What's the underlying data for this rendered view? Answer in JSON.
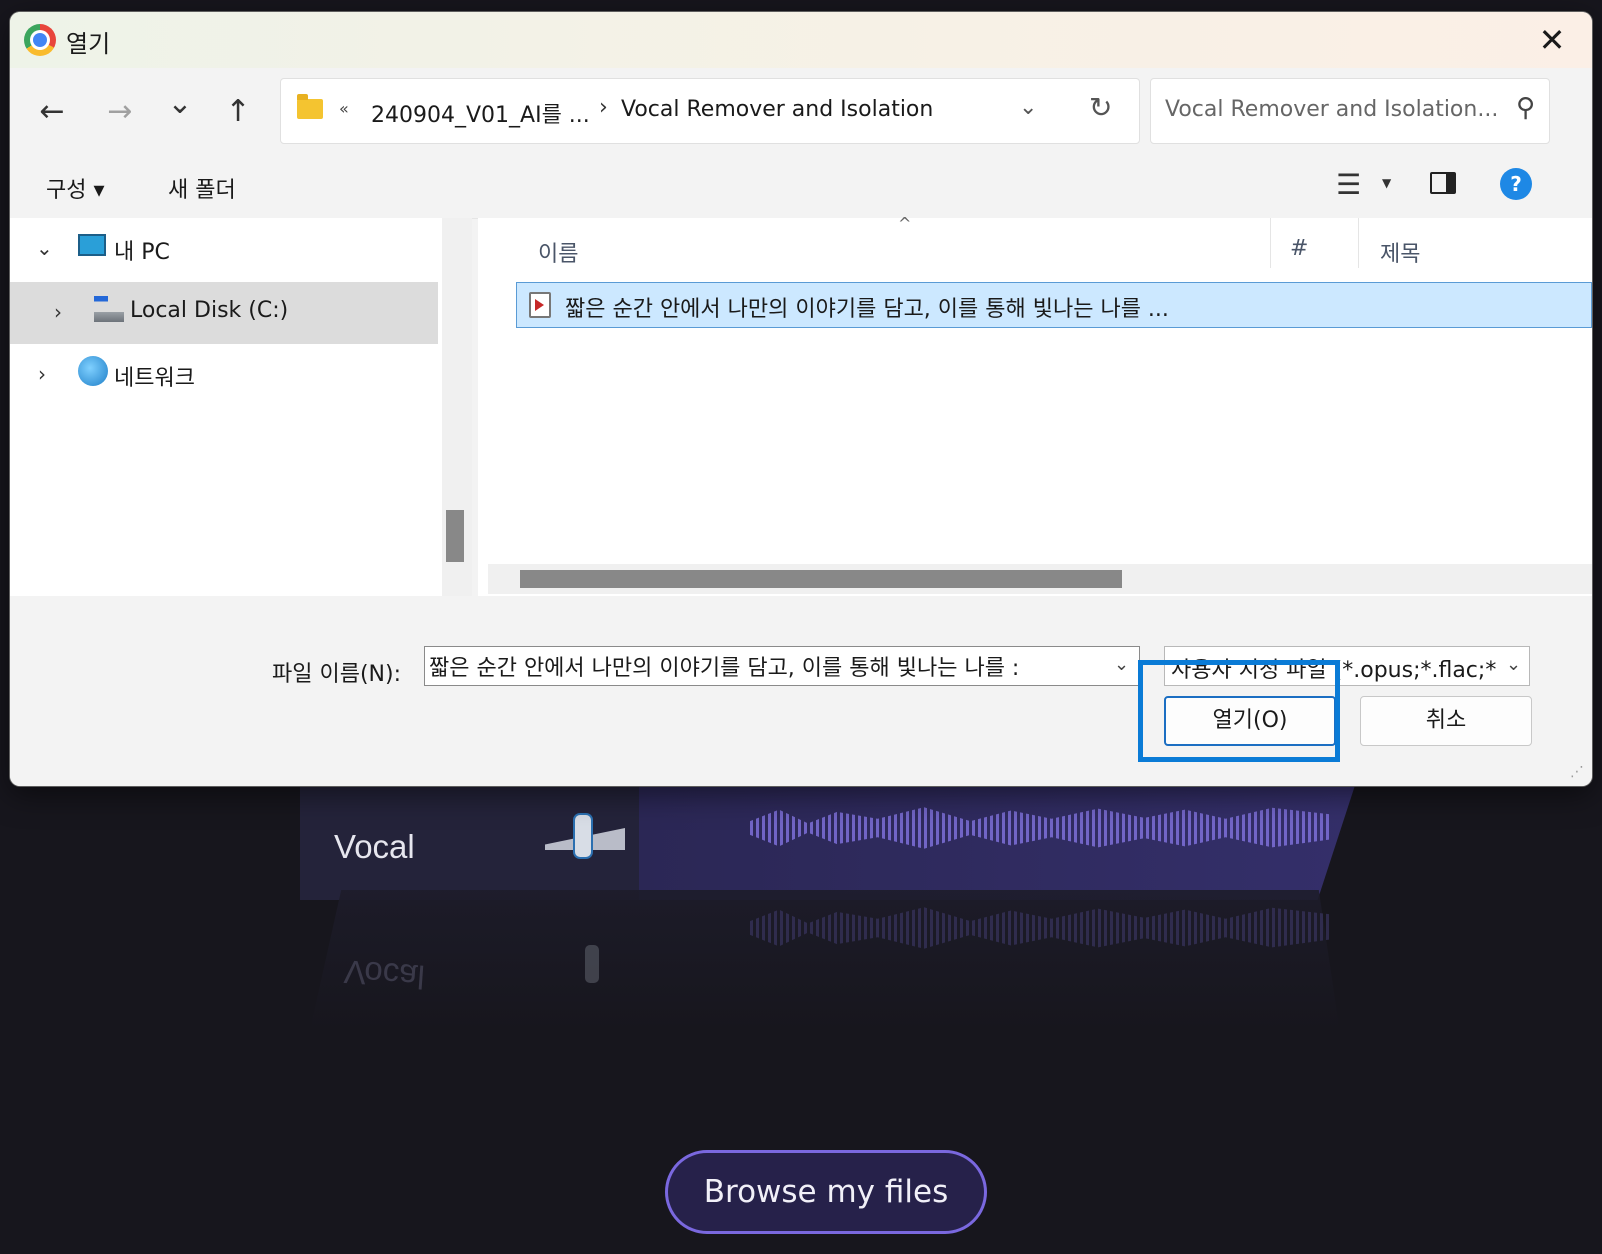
{
  "background": {
    "track_label": "Vocal",
    "track_label_reflection": "Vocal",
    "browse_button": "Browse my files"
  },
  "dialog": {
    "title": "열기",
    "nav": {
      "back_icon": "←",
      "forward_icon": "→",
      "recent_icon": "⌄",
      "up_icon": "↑"
    },
    "address": {
      "overflow": "«",
      "segments": [
        "240904_V01_AI를 ...",
        "Vocal Remover and Isolation"
      ],
      "separator": "›"
    },
    "search_placeholder": "Vocal Remover and Isolation...",
    "toolbar": {
      "organize": "구성 ▾",
      "new_folder": "새 폴더"
    },
    "tree": [
      {
        "label": "내 PC",
        "expanded": true
      },
      {
        "label": "Local Disk (C:)",
        "selected": true
      },
      {
        "label": "네트워크",
        "expanded": false
      }
    ],
    "columns": [
      "이름",
      "#",
      "제목"
    ],
    "files": [
      {
        "name": "짧은 순간 안에서 나만의 이야기를 담고, 이를 통해 빛나는 나를 ...",
        "type": "audio"
      }
    ],
    "filename_label": "파일 이름(N):",
    "filename_value": "짧은 순간 안에서 나만의 이야기를 담고, 이를 통해 빛나는 나를 :",
    "filetype_value": "사용자 지정 파일 (*.opus;*.flac;*",
    "open_button": "열기(O)",
    "cancel_button": "취소"
  },
  "colors": {
    "highlight": "#0a7bd6",
    "selection": "#cce8ff",
    "browse_border": "#7a68df"
  }
}
